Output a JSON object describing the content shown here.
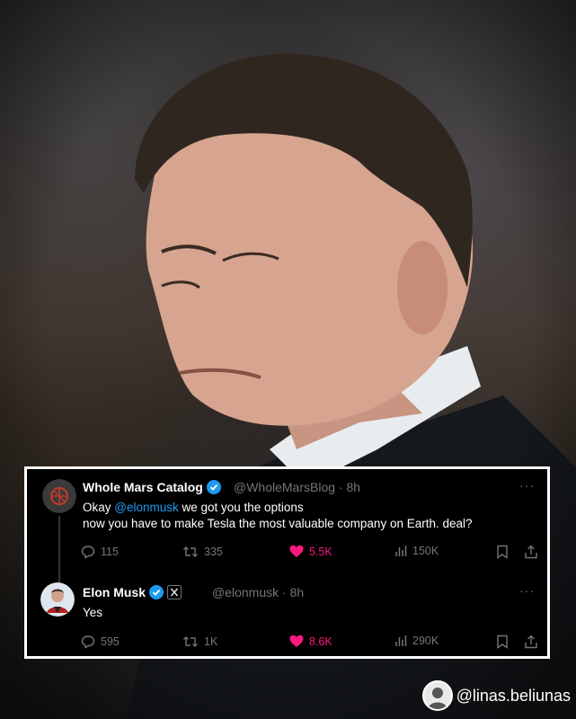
{
  "tweets": [
    {
      "display_name": "Whole Mars Catalog",
      "handle_time": "@WholeMarsBlog · 8h",
      "text_prefix": "Okay ",
      "mention": "@elonmusk",
      "text_suffix": " we got you the options",
      "text_line2": "now you have to make Tesla the most valuable company on Earth. deal?",
      "replies": "115",
      "reposts": "335",
      "likes": "5.5K",
      "views": "150K"
    },
    {
      "display_name": "Elon Musk",
      "handle_time": "@elonmusk · 8h",
      "text": "Yes",
      "replies": "595",
      "reposts": "1K",
      "likes": "8.6K",
      "views": "290K"
    }
  ],
  "more_label": "···",
  "credit": {
    "handle": "@linas.beliunas"
  },
  "colors": {
    "accent": "#1d9bf0",
    "like": "#f91880",
    "muted": "#71767b",
    "verified": "#1d9bf0"
  }
}
